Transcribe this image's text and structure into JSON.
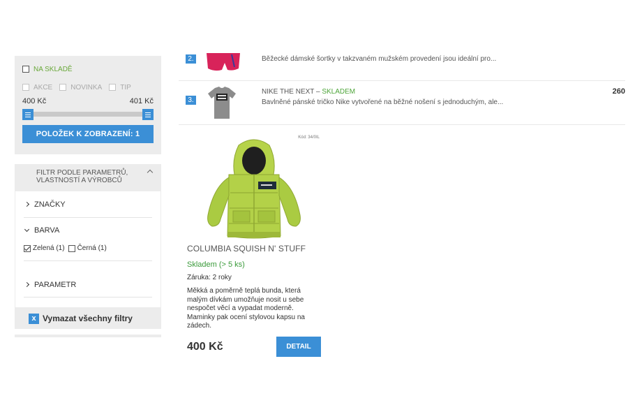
{
  "filters": {
    "in_stock_label": "NA SKLADĚ",
    "flags": [
      "AKCE",
      "NOVINKA",
      "TIP"
    ],
    "price_min": "400 Kč",
    "price_max": "401 Kč",
    "show_button": "POLOŽEK K ZOBRAZENÍ: 1"
  },
  "params": {
    "header": "FILTR PODLE PARAMETRŮ, VLASTNOSTÍ A VÝROBCŮ",
    "sections": [
      "ZNAČKY",
      "BARVA",
      "PARAMETR"
    ],
    "colors": [
      {
        "label": "Zelená (1)",
        "checked": true
      },
      {
        "label": "Černá (1)",
        "checked": false
      }
    ],
    "clear_label": "Vymazat všechny filtry",
    "clear_icon": "x"
  },
  "list": [
    {
      "num": "2.",
      "name": "",
      "stock": "",
      "desc": "Běžecké dámské šortky v takzvaném mužském provedení jsou ideální pro...",
      "price": ""
    },
    {
      "num": "3.",
      "name": "NIKE THE NEXT – ",
      "stock": "SKLADEM",
      "desc": "Bavlněné pánské tričko Nike vytvořené na běžné nošení s jednoduchým, ale...",
      "price": "260"
    }
  ],
  "product": {
    "code": "Kód: 34/0IL",
    "name": "COLUMBIA SQUISH N' STUFF",
    "availability": "Skladem (> 5 ks)",
    "warranty": "Záruka: 2 roky",
    "description": "Měkká a poměrně teplá bunda, která malým dívkám umožňuje nosit u sebe nespočet věcí a vypadat moderně. Maminky pak ocení stylovou kapsu na zádech.",
    "price": "400 Kč",
    "detail_button": "DETAIL"
  },
  "colors": {
    "accent": "#3b8fd6",
    "panel": "#ececec",
    "green": "#4ea53a",
    "jacket": "#b6d34a"
  }
}
